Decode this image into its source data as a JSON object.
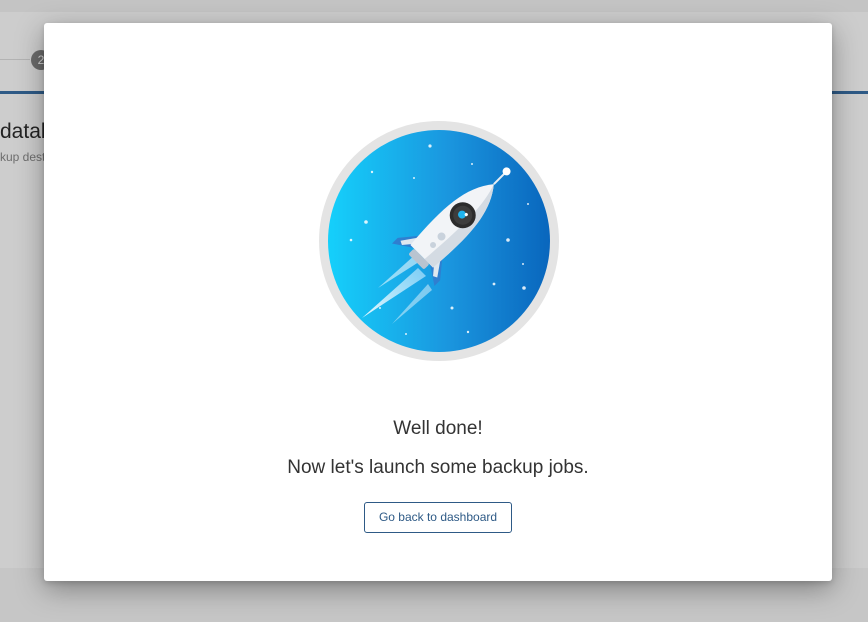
{
  "background": {
    "step_badge": "2",
    "heading_fragment": "datab",
    "subheading_fragment": "kup dest"
  },
  "modal": {
    "illustration": "rocket-launch-illustration",
    "title": "Well done!",
    "message": "Now let's launch some backup jobs.",
    "button_label": "Go back to dashboard"
  },
  "colors": {
    "accent": "#2e5a86",
    "circle_light": "#1ec8f5",
    "circle_dark": "#0a6fc2",
    "overlay": "#c9c9c9"
  }
}
